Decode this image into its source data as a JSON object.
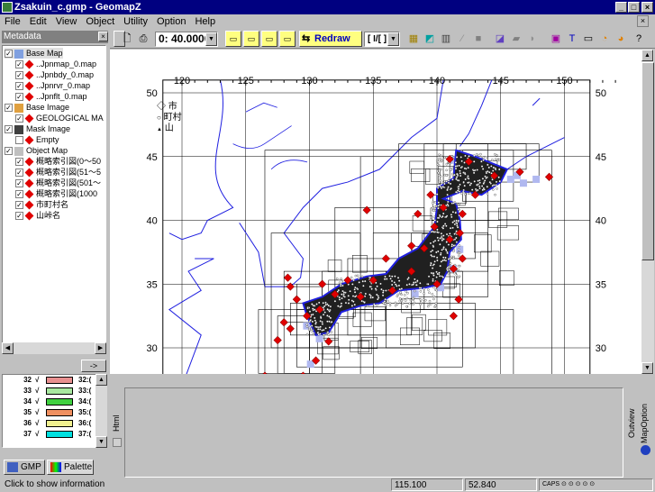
{
  "window": {
    "title": "Zsakuin_c.gmp - GeomapZ"
  },
  "menu": [
    "File",
    "Edit",
    "View",
    "Object",
    "Utility",
    "Option",
    "Help"
  ],
  "toolbar": {
    "scale_value": "0: 40.0000",
    "redraw_label": "Redraw",
    "layer_select": "[ I/[ ]"
  },
  "metadata": {
    "header": "Metadata",
    "tree": [
      {
        "label": "Base Map",
        "checked": true,
        "level": 0
      },
      {
        "label": "..Jpnmap_0.map",
        "checked": true,
        "level": 1
      },
      {
        "label": "..Jpnbdy_0.map",
        "checked": true,
        "level": 1
      },
      {
        "label": "..Jpnrvr_0.map",
        "checked": true,
        "level": 1
      },
      {
        "label": "..Jpnflt_0.map",
        "checked": true,
        "level": 1
      },
      {
        "label": "Base Image",
        "checked": true,
        "level": 0
      },
      {
        "label": "GEOLOGICAL MA",
        "checked": true,
        "level": 1
      },
      {
        "label": "Mask Image",
        "checked": true,
        "level": 0
      },
      {
        "label": "Empty",
        "checked": false,
        "level": 1
      },
      {
        "label": "Object Map",
        "checked": true,
        "level": 0
      },
      {
        "label": "概略索引図(0〜50",
        "checked": true,
        "level": 1
      },
      {
        "label": "概略索引図(51〜5",
        "checked": true,
        "level": 1
      },
      {
        "label": "概略索引図(501〜",
        "checked": true,
        "level": 1
      },
      {
        "label": "概略索引図(1000",
        "checked": true,
        "level": 1
      },
      {
        "label": "市町村名",
        "checked": true,
        "level": 1
      },
      {
        "label": "山峠名",
        "checked": true,
        "level": 1
      }
    ],
    "arrow_button": "->"
  },
  "palette": {
    "rows": [
      {
        "num": "32",
        "check": "√",
        "color": "#e89090",
        "label": "32:("
      },
      {
        "num": "33",
        "check": "√",
        "color": "#a8e8a0",
        "label": "33:("
      },
      {
        "num": "34",
        "check": "√",
        "color": "#40d040",
        "label": "34:("
      },
      {
        "num": "35",
        "check": "√",
        "color": "#f09060",
        "label": "35:("
      },
      {
        "num": "36",
        "check": "√",
        "color": "#f0f090",
        "label": "36:("
      },
      {
        "num": "37",
        "check": "√",
        "color": "#00e0e0",
        "label": "37:("
      }
    ]
  },
  "tabs": {
    "gmp": "GMP",
    "palette": "Palette"
  },
  "map": {
    "x_ticks": [
      "120",
      "125",
      "130",
      "135",
      "140",
      "145",
      "150"
    ],
    "y_ticks": [
      "50",
      "45",
      "40",
      "35",
      "30"
    ],
    "legend": [
      {
        "symbol": "◇",
        "label": "市"
      },
      {
        "symbol": "○",
        "label": "町村"
      },
      {
        "symbol": "▲",
        "label": "山"
      }
    ]
  },
  "bottom": {
    "html_label": "Html",
    "outview_label": "Outview",
    "mapoption_label": "MapOption"
  },
  "status": {
    "message": "Click to show information",
    "x": "115.100",
    "y": "52.840",
    "caps": "CAPS"
  },
  "colors": {
    "title_bg": "#000080",
    "face": "#c0c0c0",
    "marker": "#e00000",
    "coast": "#2020e0"
  }
}
